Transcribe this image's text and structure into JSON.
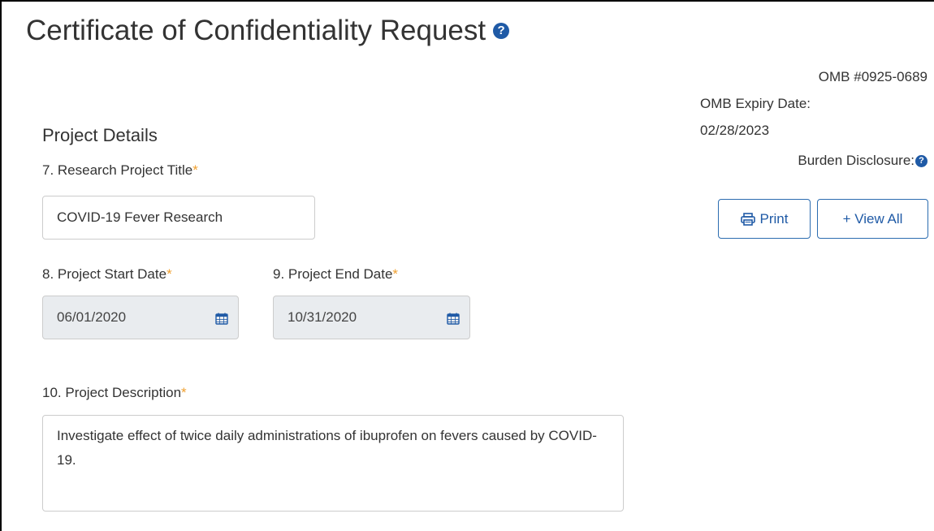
{
  "page": {
    "title": "Certificate of Confidentiality Request",
    "help_icon": "question-circle-icon"
  },
  "omb": {
    "number": "OMB #0925-0689",
    "expiry_label": "OMB Expiry Date:",
    "expiry_date": "02/28/2023",
    "burden_label": "Burden Disclosure:"
  },
  "actions": {
    "print_label": "Print",
    "print_icon": "print-icon",
    "view_all_label": "+ View All"
  },
  "section": {
    "heading": "Project Details"
  },
  "fields": {
    "title_label": "7. Research Project Title",
    "title_value": "COVID-19 Fever Research",
    "start_label": "8. Project Start Date",
    "start_value": "06/01/2020",
    "end_label": "9. Project End Date",
    "end_value": "10/31/2020",
    "description_label": "10. Project Description",
    "description_value": "Investigate effect of twice daily administrations of ibuprofen on fevers caused by COVID-19.",
    "required_marker": "*",
    "calendar_icon": "calendar-icon"
  },
  "colors": {
    "accent": "#1f5aa6",
    "required": "#f0a030",
    "disabled_bg": "#e9ecef"
  }
}
